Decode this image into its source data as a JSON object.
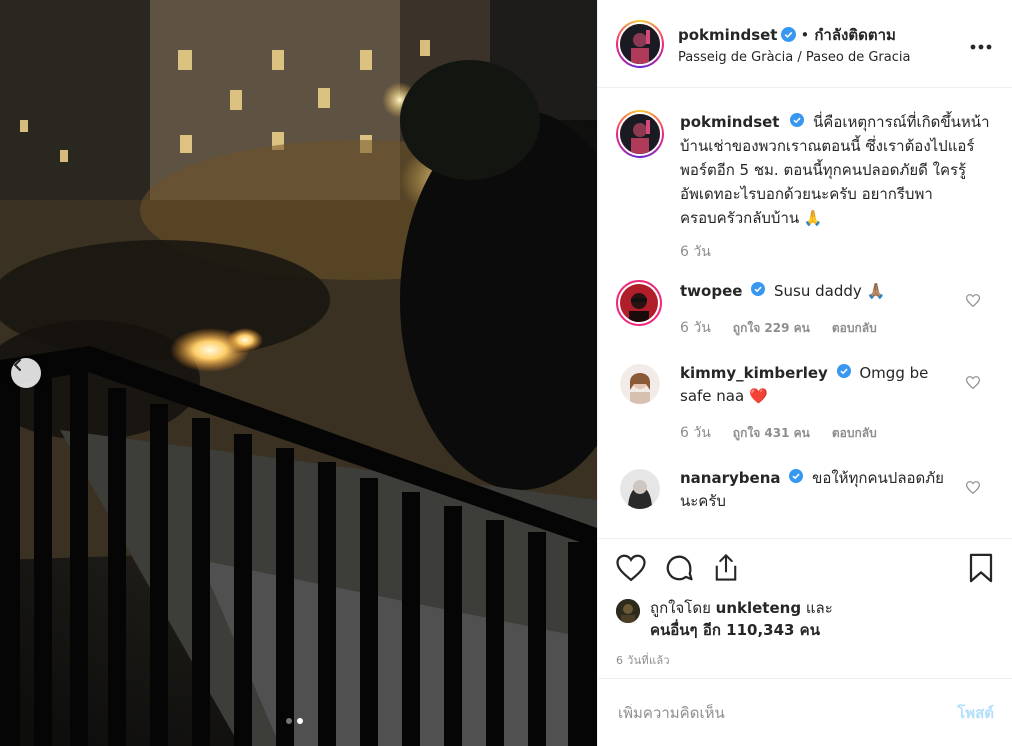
{
  "header": {
    "username": "pokmindset",
    "separator": "•",
    "follow_state": "กำลังติดตาม",
    "location": "Passeig de Gràcia / Paseo de Gracia",
    "more_icon": "more-horizontal-icon"
  },
  "caption": {
    "username": "pokmindset",
    "text": "นี่คือเหตุการณ์ที่เกิดขึ้นหน้าบ้านเช่าของพวกเราณตอนนี้ ซึ่งเราต้องไปแอร์พอร์ตอีก 5 ชม. ตอนนี้ทุกคนปลอดภัยดี ใครรู้อัพเดทอะไรบอกด้วยนะครับ อยากรีบพาครอบครัวกลับบ้าน 🙏",
    "time": "6 วัน"
  },
  "comments": [
    {
      "username": "twopee",
      "text": "Susu daddy 🙏🏽",
      "time": "6 วัน",
      "likes": "ถูกใจ 229 คน",
      "reply": "ตอบกลับ",
      "verified": true
    },
    {
      "username": "kimmy_kimberley",
      "text": "Omgg be safe naa ❤️",
      "time": "6 วัน",
      "likes": "ถูกใจ 431 คน",
      "reply": "ตอบกลับ",
      "verified": true
    },
    {
      "username": "nanarybena",
      "text": "ขอให้ทุกคนปลอดภัยนะครับ",
      "verified": true
    }
  ],
  "liked_by": {
    "prefix": "ถูกใจโดย",
    "user": "unkleteng",
    "and": "และ",
    "others": "คนอื่นๆ อีก 110,343 คน"
  },
  "posted_ago": "6 วันที่แล้ว",
  "add_comment": {
    "placeholder": "เพิ่มความคิดเห็น",
    "post_label": "โพสต์"
  },
  "carousel": {
    "slide_count": 2,
    "active_index": 1
  },
  "colors": {
    "verified": "#3897f0",
    "text": "#262626",
    "muted": "#8e8e8e",
    "post_button_disabled": "#b2dffc",
    "heart": "#ed4956"
  }
}
